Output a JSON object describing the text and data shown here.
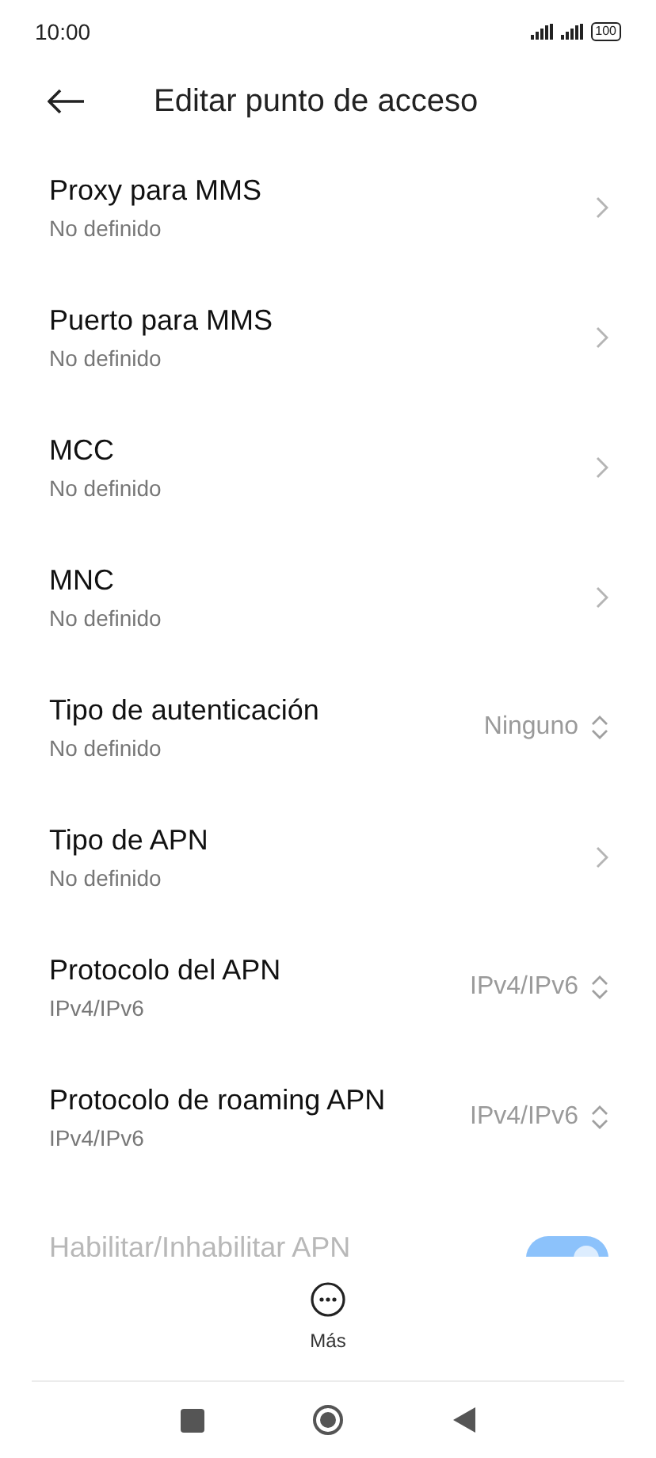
{
  "status_bar": {
    "time": "10:00",
    "battery": "100"
  },
  "header": {
    "title": "Editar punto de acceso"
  },
  "settings": [
    {
      "kind": "link",
      "title": "Proxy para MMS",
      "subtitle": "No definido"
    },
    {
      "kind": "link",
      "title": "Puerto para MMS",
      "subtitle": "No definido"
    },
    {
      "kind": "link",
      "title": "MCC",
      "subtitle": "No definido"
    },
    {
      "kind": "link",
      "title": "MNC",
      "subtitle": "No definido"
    },
    {
      "kind": "select",
      "title": "Tipo de autenticación",
      "subtitle": "No definido",
      "value": "Ninguno"
    },
    {
      "kind": "link",
      "title": "Tipo de APN",
      "subtitle": "No definido"
    },
    {
      "kind": "select",
      "title": "Protocolo del APN",
      "subtitle": "IPv4/IPv6",
      "value": "IPv4/IPv6"
    },
    {
      "kind": "select",
      "title": "Protocolo de roaming APN",
      "subtitle": "IPv4/IPv6",
      "value": "IPv4/IPv6"
    },
    {
      "kind": "toggle",
      "title": "Habilitar/Inhabilitar APN",
      "disabled": true,
      "on": true
    }
  ],
  "bottom_action": {
    "label": "Más"
  }
}
